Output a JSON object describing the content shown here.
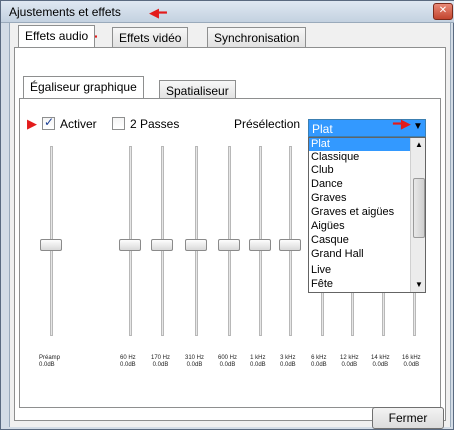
{
  "window": {
    "title": "Ajustements et effets",
    "close_glyph": "✕"
  },
  "main_tabs": [
    "Effets audio",
    "Effets vidéo",
    "Synchronisation"
  ],
  "sub_tabs": [
    "Égaliseur graphique",
    "Spatialiseur"
  ],
  "controls": {
    "enable_label": "Activer",
    "enable_checked": true,
    "two_pass_label": "2 Passes",
    "two_pass_checked": false,
    "preset_label": "Présélection",
    "preset_value": "Plat"
  },
  "preset_options": [
    "Plat",
    "Classique",
    "Club",
    "Dance",
    "Graves",
    "Graves et aigües",
    "Aigües",
    "Casque",
    "Grand Hall",
    "Live",
    "Fête"
  ],
  "equalizer": {
    "preamp": {
      "label": "Préamp",
      "gain": "0.0dB"
    },
    "bands": [
      {
        "freq": "60 Hz",
        "gain": "0.0dB"
      },
      {
        "freq": "170 Hz",
        "gain": "0.0dB"
      },
      {
        "freq": "310 Hz",
        "gain": "0.0dB"
      },
      {
        "freq": "600 Hz",
        "gain": "0.0dB"
      },
      {
        "freq": "1 kHz",
        "gain": "0.0dB"
      },
      {
        "freq": "3 kHz",
        "gain": "0.0dB"
      },
      {
        "freq": "6 kHz",
        "gain": "0.0dB"
      },
      {
        "freq": "12 kHz",
        "gain": "0.0dB"
      },
      {
        "freq": "14 kHz",
        "gain": "0.0dB"
      },
      {
        "freq": "16 kHz",
        "gain": "0.0dB"
      }
    ]
  },
  "buttons": {
    "close": "Fermer"
  },
  "annotation_color": "#e31b1b"
}
